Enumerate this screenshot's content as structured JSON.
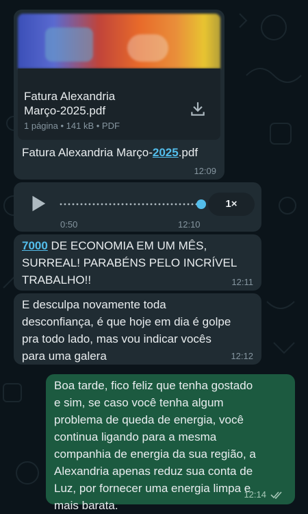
{
  "chat": {
    "pdf_message": {
      "file_title_line1": "Fatura Alexandria",
      "file_title_line2": "Março-2025.pdf",
      "file_meta": "1 página • 141 kB • PDF",
      "caption_prefix": "Fatura Alexandria Março-",
      "caption_link": "2025",
      "caption_suffix": ".pdf",
      "time": "12:09"
    },
    "audio_message": {
      "elapsed": "0:50",
      "time": "12:10",
      "speed": "1×",
      "progress": 1.0
    },
    "message_economy": {
      "link": "7000",
      "text_line1": " DE ECONOMIA EM UM MÊS,",
      "text_line2": "SURREAL! PARABÉNS PELO INCRÍVEL",
      "text_line3": "TRABALHO!!",
      "time": "12:11"
    },
    "message_desculpa": {
      "lines": [
        "E desculpa novamente toda",
        "desconfiança, é que hoje em dia é golpe",
        "pra todo lado, mas vou indicar vocês",
        "para uma galera"
      ],
      "time": "12:12"
    },
    "message_reply": {
      "lines": [
        "Boa tarde, fico feliz que tenha gostado",
        "e sim, se caso você tenha algum",
        "problema de queda de energia, você",
        "continua ligando para a mesma",
        "companhia de energia da sua região, a",
        "Alexandria apenas reduz sua conta de",
        "Luz, por fornecer uma energia limpa e",
        "mais barata."
      ],
      "time": "12:14",
      "status_icon": "double-check-icon"
    }
  },
  "colors": {
    "background": "#0b141a",
    "incoming_bubble": "#202c33",
    "outgoing_bubble": "#1c5a40",
    "link": "#53bdeb",
    "audio_dot": "#53bdeb"
  }
}
